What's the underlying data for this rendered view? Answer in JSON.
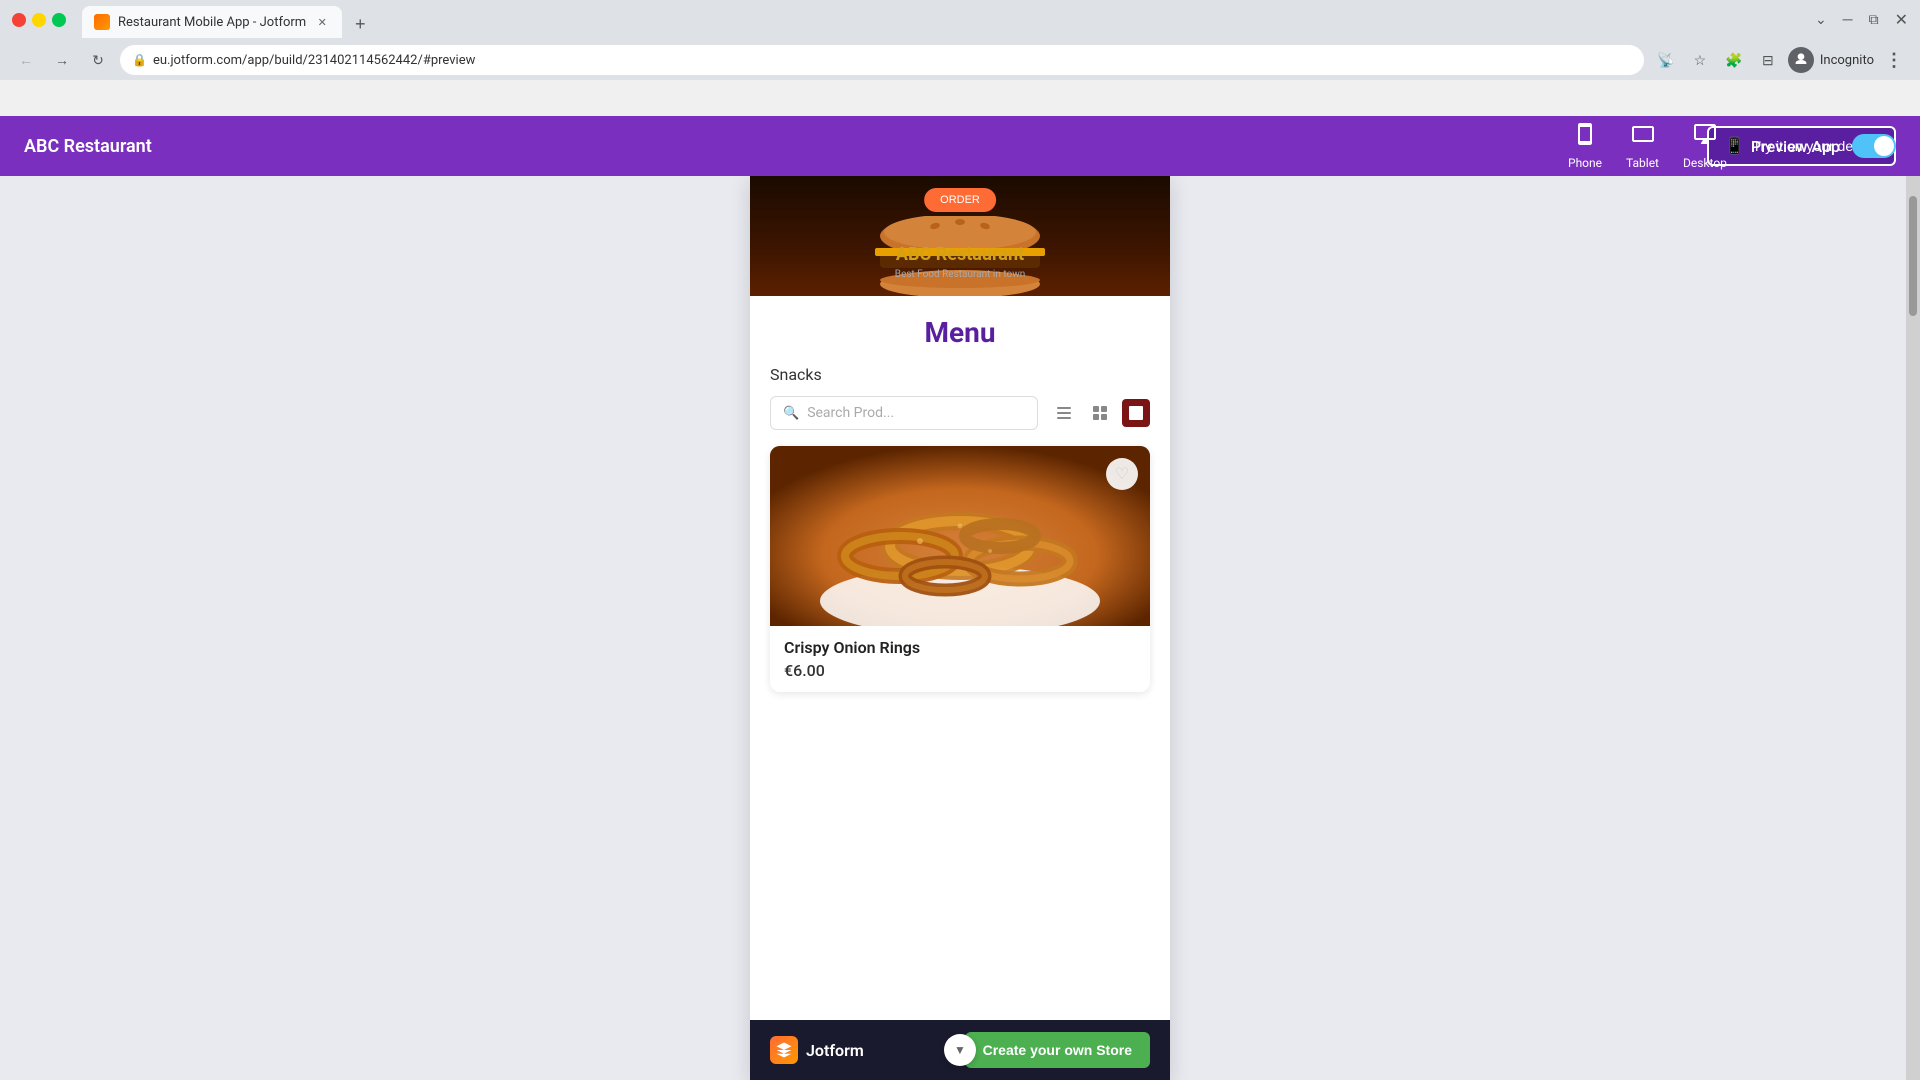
{
  "browser": {
    "tab_title": "Restaurant Mobile App - Jotform",
    "url": "eu.jotform.com/app/build/231402114562442/#preview",
    "new_tab_label": "+"
  },
  "app_header": {
    "title": "ABC Restaurant",
    "try_btn_label": "Try it on your device",
    "phone_label": "Phone",
    "tablet_label": "Tablet",
    "desktop_label": "Desktop",
    "preview_app_label": "Preview App"
  },
  "restaurant": {
    "name": "ABC Restaurant",
    "subtitle": "Best Food Restaurant in town"
  },
  "menu": {
    "title": "Menu",
    "category": "Snacks",
    "search_placeholder": "Search Prod..."
  },
  "product": {
    "name": "Crispy Onion Rings",
    "price": "€6.00"
  },
  "jotform_bar": {
    "logo_text": "Jotform",
    "cta_label": "Create your own Store"
  }
}
